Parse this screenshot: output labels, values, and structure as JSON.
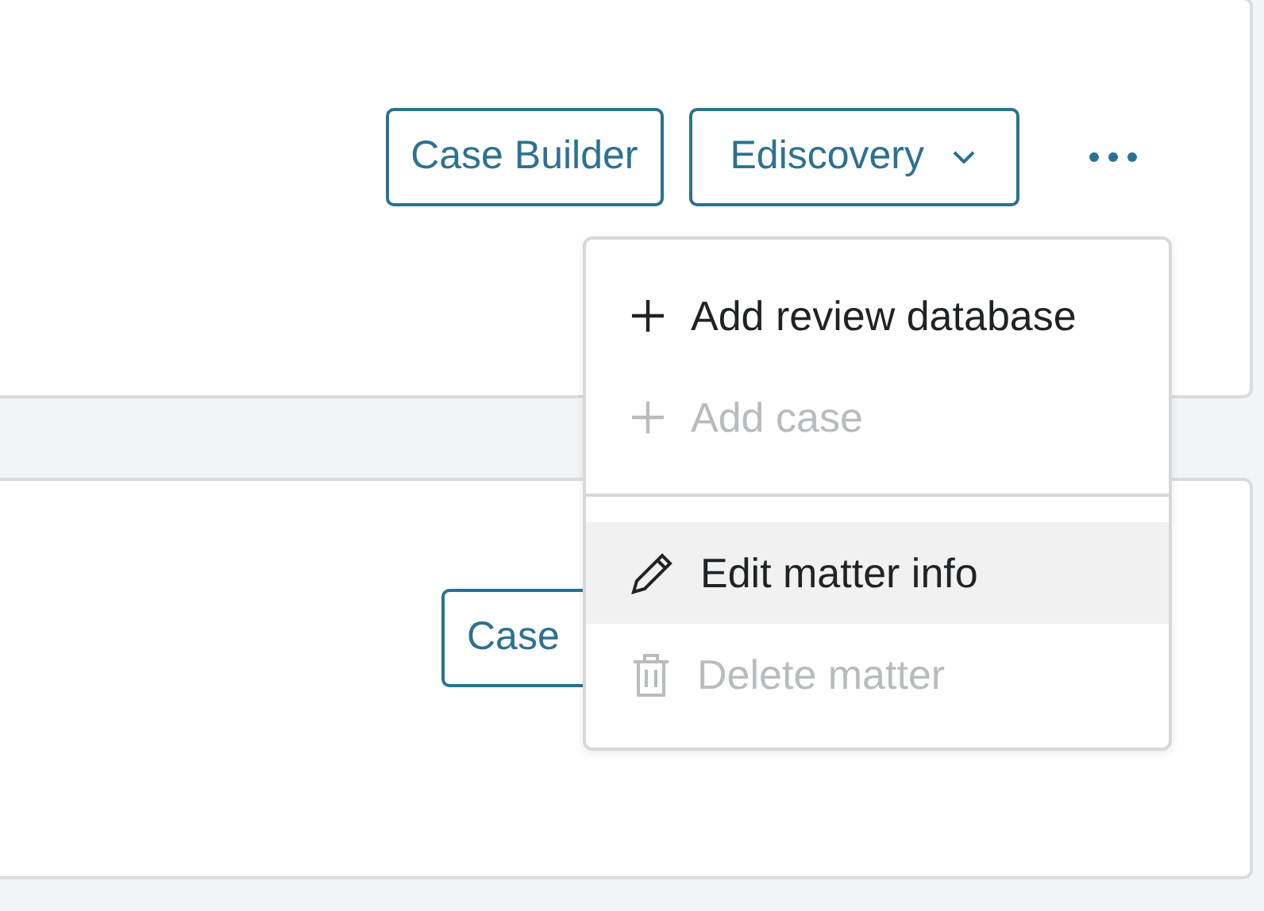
{
  "cards": [
    {
      "buttons": [
        {
          "label": "Case Builder",
          "kind": "plain"
        },
        {
          "label": "Ediscovery",
          "kind": "dropdown"
        }
      ],
      "more_button": true
    },
    {
      "buttons": [
        {
          "label": "Case",
          "kind": "plain"
        }
      ],
      "more_button": false
    }
  ],
  "menu": {
    "sections": [
      {
        "items": [
          {
            "label": "Add review database",
            "kind": "plus",
            "disabled": false,
            "highlighted": false
          },
          {
            "label": "Add case",
            "kind": "plus",
            "disabled": true,
            "highlighted": false
          }
        ]
      },
      {
        "items": [
          {
            "label": "Edit matter info",
            "kind": "pencil",
            "disabled": false,
            "highlighted": true
          },
          {
            "label": "Delete matter",
            "kind": "trash",
            "disabled": true,
            "highlighted": false
          }
        ]
      }
    ]
  }
}
